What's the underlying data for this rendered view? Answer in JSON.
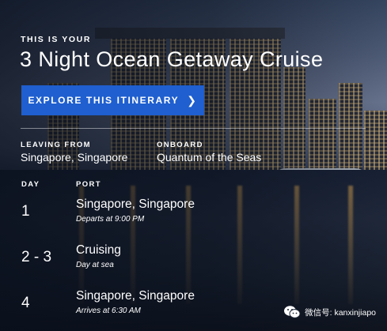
{
  "header": {
    "eyebrow": "THIS IS YOUR",
    "title": "3 Night Ocean Getaway Cruise",
    "cta_label": "EXPLORE THIS ITINERARY",
    "cta_icon": "chevron-right-icon",
    "accent_color": "#1f5fcf"
  },
  "info": {
    "leaving_label": "LEAVING FROM",
    "leaving_value": "Singapore, Singapore",
    "onboard_label": "ONBOARD",
    "onboard_value": "Quantum of the Seas"
  },
  "itinerary": {
    "day_header": "DAY",
    "port_header": "PORT",
    "rows": [
      {
        "day": "1",
        "port": "Singapore, Singapore",
        "detail": "Departs at 9:00 PM"
      },
      {
        "day": "2 - 3",
        "port": "Cruising",
        "detail": "Day at sea"
      },
      {
        "day": "4",
        "port": "Singapore, Singapore",
        "detail": "Arrives at 6:30 AM"
      }
    ]
  },
  "watermark": {
    "icon": "wechat-icon",
    "text": "微信号: kanxinjiapo"
  }
}
